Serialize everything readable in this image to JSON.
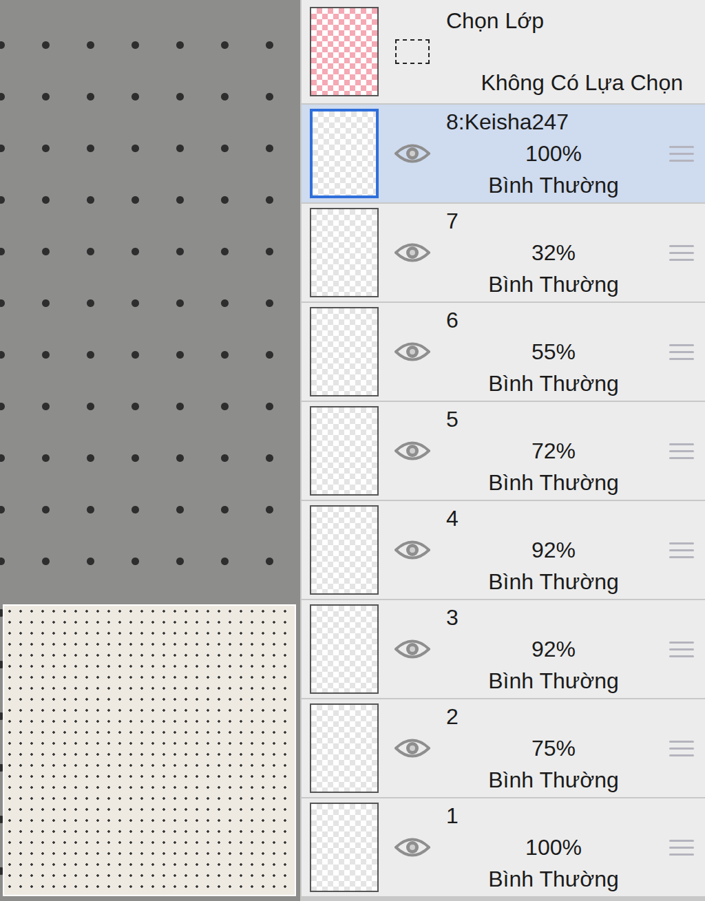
{
  "selection_layer": {
    "title": "Chọn Lớp",
    "status": "Không Có Lựa Chọn"
  },
  "layers": [
    {
      "name": "8:Keisha247",
      "opacity": "100%",
      "blend": "Bình Thường",
      "visible": true,
      "selected": true
    },
    {
      "name": "7",
      "opacity": "32%",
      "blend": "Bình Thường",
      "visible": true,
      "selected": false
    },
    {
      "name": "6",
      "opacity": "55%",
      "blend": "Bình Thường",
      "visible": true,
      "selected": false
    },
    {
      "name": "5",
      "opacity": "72%",
      "blend": "Bình Thường",
      "visible": true,
      "selected": false
    },
    {
      "name": "4",
      "opacity": "92%",
      "blend": "Bình Thường",
      "visible": true,
      "selected": false
    },
    {
      "name": "3",
      "opacity": "92%",
      "blend": "Bình Thường",
      "visible": true,
      "selected": false
    },
    {
      "name": "2",
      "opacity": "75%",
      "blend": "Bình Thường",
      "visible": true,
      "selected": false
    },
    {
      "name": "1",
      "opacity": "100%",
      "blend": "Bình Thường",
      "visible": true,
      "selected": false
    }
  ]
}
